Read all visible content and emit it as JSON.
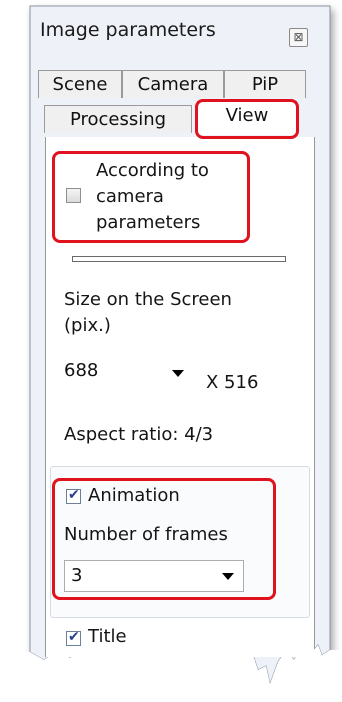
{
  "window": {
    "title": "Image parameters",
    "close_label": "⊠"
  },
  "tabs": {
    "row1": [
      "Scene",
      "Camera",
      "PiP"
    ],
    "row2": [
      "Processing",
      "View"
    ],
    "active": "View"
  },
  "camera_params": {
    "label_lines": [
      "According to",
      "camera",
      "parameters"
    ],
    "checked": false
  },
  "screen_size": {
    "label_lines": [
      "Size on the Screen",
      "(pix.)"
    ],
    "width_value": "688",
    "height_text": "X 516"
  },
  "aspect_ratio": "Aspect ratio: 4/3",
  "animation": {
    "label": "Animation",
    "checked": true,
    "frames_label": "Number of frames",
    "frames_value": "3"
  },
  "title_option": {
    "label": "Title",
    "checked": true
  },
  "colors": {
    "highlight": "#e0121e",
    "check": "#2a3f8f"
  }
}
